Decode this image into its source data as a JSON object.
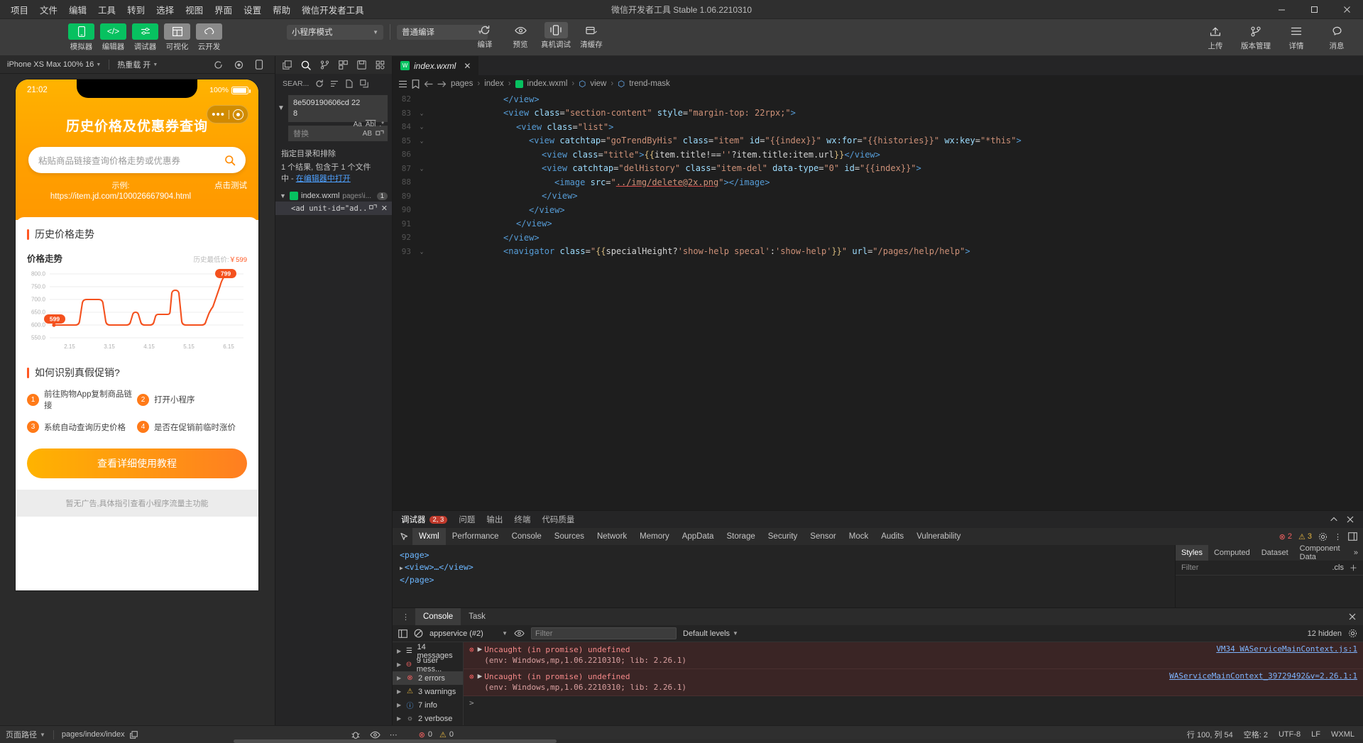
{
  "window": {
    "title": "微信开发者工具 Stable 1.06.2210310"
  },
  "menu": {
    "items": [
      "项目",
      "文件",
      "编辑",
      "工具",
      "转到",
      "选择",
      "视图",
      "界面",
      "设置",
      "帮助",
      "微信开发者工具"
    ]
  },
  "window_controls": {
    "minimize": "–",
    "maximize": "❐",
    "close": "✕"
  },
  "toolbar": {
    "modes": [
      {
        "icon": "phone-icon",
        "label": "模拟器",
        "color": "#07c160"
      },
      {
        "icon": "code-icon",
        "label": "编辑器",
        "color": "#07c160"
      },
      {
        "icon": "debug-icon",
        "label": "调试器",
        "color": "#07c160"
      },
      {
        "icon": "layout-icon",
        "label": "可视化",
        "color": "#8a8a8a"
      },
      {
        "icon": "cloud-icon",
        "label": "云开发",
        "color": "#8a8a8a"
      }
    ],
    "mode_select": "小程序模式",
    "compile_select": "普通编译",
    "actions": [
      {
        "icon": "refresh-icon",
        "label": "编译"
      },
      {
        "icon": "eye-icon",
        "label": "预览"
      },
      {
        "icon": "device-icon",
        "label": "真机调试",
        "active": true
      },
      {
        "icon": "clear-cache-icon",
        "label": "清缓存"
      }
    ],
    "right": [
      {
        "icon": "upload-icon",
        "label": "上传"
      },
      {
        "icon": "version-icon",
        "label": "版本管理"
      },
      {
        "icon": "details-icon",
        "label": "详情"
      },
      {
        "icon": "message-icon",
        "label": "消息"
      }
    ]
  },
  "simulator": {
    "device": "iPhone XS Max 100% 16",
    "mode": "热重载 开",
    "phone": {
      "status_time": "21:02",
      "battery_percent": "100%",
      "title": "历史价格及优惠券查询",
      "search_placeholder": "粘贴商品链接查询价格走势或优惠券",
      "example_label": "示例:",
      "example_url": "https://item.jd.com/100026667904.html",
      "try_label": "点击测试",
      "section1_title": "历史价格走势",
      "chart_title": "价格走势",
      "chart_legend": "历史最低价:",
      "chart_legend_value": "￥599",
      "section2_title": "如何识别真假促销?",
      "steps": [
        {
          "num": "1",
          "text": "前往购物App复制商品链接"
        },
        {
          "num": "2",
          "text": "打开小程序"
        },
        {
          "num": "3",
          "text": "系统自动查询历史价格"
        },
        {
          "num": "4",
          "text": "是否在促销前临时涨价"
        }
      ],
      "tutorial_button": "查看详细使用教程",
      "ad_text": "暂无广告,具体指引查看小程序流量主功能"
    }
  },
  "chart_data": {
    "type": "line",
    "title": "价格走势",
    "xlabel": "",
    "ylabel": "",
    "ylim": [
      550,
      800
    ],
    "yticks": [
      800.0,
      750.0,
      700.0,
      650.0,
      600.0,
      550.0
    ],
    "ytick_labels": [
      "800.0",
      "750.0",
      "700.0",
      "650.0",
      "600.0",
      "550.0"
    ],
    "xticks": [
      "2.15",
      "3.15",
      "4.15",
      "5.15",
      "6.15"
    ],
    "grid": true,
    "series": [
      {
        "name": "价格",
        "color": "#f4511e",
        "x": [
          0,
          2,
          4,
          6,
          8,
          10,
          12,
          14,
          16,
          18,
          20,
          22,
          24,
          26,
          28,
          30,
          32,
          34,
          36,
          38,
          40,
          42,
          44,
          46,
          48,
          50,
          52,
          54,
          56,
          58,
          60,
          62,
          64,
          66,
          68,
          70,
          72,
          74,
          76,
          78,
          80,
          82,
          84,
          86,
          88,
          90,
          92,
          94,
          96,
          98,
          100
        ],
        "values": [
          599,
          599,
          599,
          599,
          599,
          599,
          599,
          599,
          599,
          599,
          599,
          599,
          600,
          700,
          700,
          700,
          700,
          700,
          700,
          660,
          600,
          600,
          600,
          600,
          600,
          600,
          600,
          600,
          650,
          650,
          600,
          600,
          600,
          630,
          630,
          630,
          630,
          640,
          730,
          730,
          700,
          610,
          600,
          600,
          600,
          600,
          620,
          700,
          790,
          799,
          799
        ]
      }
    ],
    "annotations": [
      {
        "label": "799",
        "value": 799,
        "color": "#f4511e",
        "position": "top-right"
      },
      {
        "label": "599",
        "value": 599,
        "color": "#f4511e",
        "position": "bottom-left"
      }
    ]
  },
  "search_panel": {
    "icons": [
      "copy-icon",
      "search-icon",
      "branch-icon",
      "grid-icon",
      "save-icon",
      "extension-icon"
    ],
    "label": "SEAR...",
    "refresh_icon": "refresh-icon",
    "toolbar_icons": [
      "clear-icon",
      "new-file-icon",
      "collapse-icon"
    ],
    "query": "8e509190606cd\n228",
    "query_icons": [
      "Aa",
      "Abl",
      ".*"
    ],
    "replace_placeholder": "替换",
    "replace_icons": [
      "AB",
      "replace-all-icon"
    ],
    "include_label": "指定目录和排除",
    "results_line1": "1 个结果, 包含于 1 个文件",
    "results_line2_prefix": "中 - ",
    "results_link": "在编辑器中打开",
    "tree_file": "index.wxml",
    "tree_path": "pages\\i...",
    "tree_count": "1",
    "tree_match": "<ad unit-id=\"ad..."
  },
  "editor": {
    "tab": {
      "name": "index.wxml",
      "icon": "wxml-file-icon",
      "close": "✕"
    },
    "breadcrumb": [
      "pages",
      "index",
      "index.wxml",
      "view",
      "trend-mask"
    ],
    "breadcrumb_icons": [
      "list-icon",
      "bookmark-icon",
      "back-arrow-icon",
      "forward-arrow-icon"
    ],
    "lines": [
      {
        "num": "82",
        "fold": "",
        "indent": 6,
        "html": "<span class='t-tag'>&lt;/view&gt;</span>"
      },
      {
        "num": "83",
        "fold": "v",
        "indent": 6,
        "html": "<span class='t-tag'>&lt;view</span> <span class='t-attr'>class</span><span class='t-pun'>=</span><span class='t-str'>\"section-content\"</span> <span class='t-attr'>style</span><span class='t-pun'>=</span><span class='t-str'>\"margin-top: 22rpx;\"</span><span class='t-tag'>&gt;</span>"
      },
      {
        "num": "84",
        "fold": "v",
        "indent": 7,
        "html": "<span class='t-tag'>&lt;view</span> <span class='t-attr'>class</span><span class='t-pun'>=</span><span class='t-str'>\"list\"</span><span class='t-tag'>&gt;</span>"
      },
      {
        "num": "85",
        "fold": "v",
        "indent": 8,
        "html": "<span class='t-tag'>&lt;view</span> <span class='t-attr'>catchtap</span><span class='t-pun'>=</span><span class='t-str'>\"goTrendByHis\"</span> <span class='t-attr'>class</span><span class='t-pun'>=</span><span class='t-str'>\"item\"</span> <span class='t-attr'>id</span><span class='t-pun'>=</span><span class='t-str'>\"{{index}}\"</span> <span class='t-attr'>wx:for</span><span class='t-pun'>=</span><span class='t-str'>\"{{histories}}\"</span> <span class='t-attr'>wx:key</span><span class='t-pun'>=</span><span class='t-str'>\"*this\"</span><span class='t-tag'>&gt;</span>"
      },
      {
        "num": "86",
        "fold": "",
        "indent": 9,
        "html": "<span class='t-tag'>&lt;view</span> <span class='t-attr'>class</span><span class='t-pun'>=</span><span class='t-str'>\"title\"</span><span class='t-tag'>&gt;</span><span class='t-brace'>{{</span><span class='t-pun'>item.title!==</span><span class='t-str'>''</span><span class='t-pun'>?item.title:item.url</span><span class='t-brace'>}}</span><span class='t-tag'>&lt;/view&gt;</span>"
      },
      {
        "num": "87",
        "fold": "v",
        "indent": 9,
        "html": "<span class='t-tag'>&lt;view</span> <span class='t-attr'>catchtap</span><span class='t-pun'>=</span><span class='t-str'>\"delHistory\"</span> <span class='t-attr'>class</span><span class='t-pun'>=</span><span class='t-str'>\"item-del\"</span> <span class='t-attr'>data-type</span><span class='t-pun'>=</span><span class='t-str'>\"0\"</span> <span class='t-attr'>id</span><span class='t-pun'>=</span><span class='t-str'>\"{{index}}\"</span><span class='t-tag'>&gt;</span>"
      },
      {
        "num": "88",
        "fold": "",
        "indent": 10,
        "html": "<span class='t-tag'>&lt;image</span> <span class='t-attr'>src</span><span class='t-pun'>=</span><span class='t-str'>\"</span><span class='t-link'>../img/delete@2x.png</span><span class='t-str'>\"</span><span class='t-tag'>&gt;&lt;/image&gt;</span>"
      },
      {
        "num": "89",
        "fold": "",
        "indent": 9,
        "html": "<span class='t-tag'>&lt;/view&gt;</span>"
      },
      {
        "num": "90",
        "fold": "",
        "indent": 8,
        "html": "<span class='t-tag'>&lt;/view&gt;</span>"
      },
      {
        "num": "91",
        "fold": "",
        "indent": 7,
        "html": "<span class='t-tag'>&lt;/view&gt;</span>"
      },
      {
        "num": "92",
        "fold": "",
        "indent": 6,
        "html": "<span class='t-tag'>&lt;/view&gt;</span>"
      },
      {
        "num": "93",
        "fold": "v",
        "indent": 6,
        "html": "<span class='t-tag'>&lt;navigator</span> <span class='t-attr'>class</span><span class='t-pun'>=</span><span class='t-str'>\"</span><span class='t-brace'>{{</span><span class='t-pun'>specialHeight?</span><span class='t-str'>'show-help specal'</span><span class='t-pun'>:</span><span class='t-str'>'show-help'</span><span class='t-brace'>}}</span><span class='t-str'>\"</span> <span class='t-attr'>url</span><span class='t-pun'>=</span><span class='t-str'>\"/pages/help/help\"</span><span class='t-tag'>&gt;</span>"
      }
    ]
  },
  "debugger": {
    "title": "调试器",
    "badge": "2, 3",
    "tabs": [
      "问题",
      "输出",
      "终端",
      "代码质量"
    ],
    "devtools_tabs": [
      "Wxml",
      "Performance",
      "Console",
      "Sources",
      "Network",
      "Memory",
      "AppData",
      "Storage",
      "Security",
      "Sensor",
      "Mock",
      "Audits",
      "Vulnerability"
    ],
    "active_devtool": "Wxml",
    "error_count": "2",
    "warning_count": "3",
    "wxml_tree": [
      "<page>",
      "<view>…</view>",
      "</page>"
    ],
    "styles": {
      "tabs": [
        "Styles",
        "Computed",
        "Dataset",
        "Component Data"
      ],
      "active": "Styles",
      "filter_placeholder": "Filter",
      "cls": ".cls"
    }
  },
  "console": {
    "tabs": [
      "Console",
      "Task"
    ],
    "active_tab": "Console",
    "context": "appservice (#2)",
    "filter_placeholder": "Filter",
    "levels": "Default levels",
    "hidden": "12 hidden",
    "sidebar": [
      {
        "icon": "list-icon",
        "label": "14 messages"
      },
      {
        "icon": "user-icon",
        "label": "9 user mess..."
      },
      {
        "icon": "error-icon",
        "label": "2 errors",
        "selected": true
      },
      {
        "icon": "warning-icon",
        "label": "3 warnings"
      },
      {
        "icon": "info-icon",
        "label": "7 info"
      },
      {
        "icon": "verbose-icon",
        "label": "2 verbose"
      }
    ],
    "logs": [
      {
        "level": "error",
        "message": "Uncaught (in promise) undefined",
        "detail": "(env: Windows,mp,1.06.2210310; lib: 2.26.1)",
        "source": "VM34 WAServiceMainContext.js:1"
      },
      {
        "level": "error",
        "message": "Uncaught (in promise) undefined",
        "detail": "(env: Windows,mp,1.06.2210310; lib: 2.26.1)",
        "source": "WAServiceMainContext_39729492&v=2.26.1:1"
      }
    ],
    "prompt": ">"
  },
  "statusbar": {
    "page_path_label": "页面路径",
    "page_path": "pages/index/index",
    "copy_icon": "copy-icon",
    "errors": "0",
    "warnings": "0",
    "right": [
      "行 100, 列 54",
      "空格: 2",
      "UTF-8",
      "LF",
      "WXML"
    ],
    "mid_icons": [
      "bug-icon",
      "eye-icon",
      "more-icon"
    ]
  }
}
